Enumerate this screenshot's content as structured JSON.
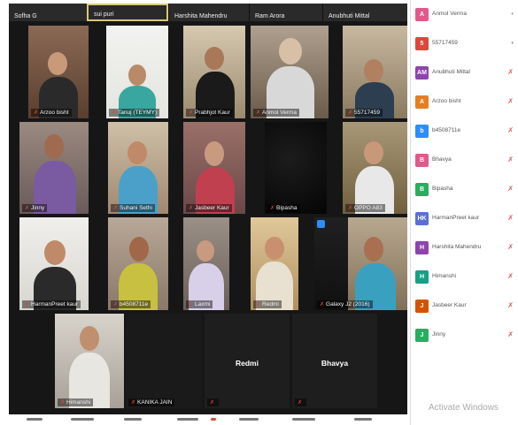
{
  "app": {
    "title": ""
  },
  "top_strip": [
    {
      "name": "Sofha G"
    },
    {
      "name": "sui puri",
      "active": true
    },
    {
      "name": "Harshita Mahendru"
    },
    {
      "name": "Ram Arora"
    },
    {
      "name": "Anubhuti Mittal"
    }
  ],
  "gallery": {
    "row1": [
      {
        "name": "Arzoo bisht"
      },
      {
        "name": "Tanuj (TEYMY)"
      },
      {
        "name": "Prabhjot Kaur"
      },
      {
        "name": "Anmol Verma"
      },
      {
        "name": "55717459"
      }
    ],
    "row2": [
      {
        "name": "Jinny"
      },
      {
        "name": "Suhani Sethi"
      },
      {
        "name": "Jasbeer Kaur"
      },
      {
        "name": "Bipasha"
      },
      {
        "name": "OPPO A83"
      }
    ],
    "row3": [
      {
        "name": "HarmanPreet kaur"
      },
      {
        "name": "b4508711e"
      },
      {
        "name": "Laxmi"
      },
      {
        "name": "Redmi"
      },
      {
        "name": "Galaxy J2 (2016)"
      }
    ],
    "row4": [
      {
        "name": "Himanshi"
      },
      {
        "name": "KANIKA JAIN"
      },
      {
        "name": "Redmi"
      },
      {
        "name": "Bhavya"
      }
    ]
  },
  "participants": [
    {
      "name": "Anmol Verma",
      "initials": "A",
      "color": "#e05a8a",
      "muted": false
    },
    {
      "name": "55717459",
      "initials": "5",
      "color": "#e0463b",
      "muted": false
    },
    {
      "name": "Anubhuti Mittal",
      "initials": "AM",
      "color": "#8e44ad",
      "muted": true
    },
    {
      "name": "Arzoo bisht",
      "initials": "A",
      "color": "#e67e22",
      "muted": true
    },
    {
      "name": "b4508711e",
      "initials": "b",
      "color": "#2d8cff",
      "muted": true
    },
    {
      "name": "Bhavya",
      "initials": "B",
      "color": "#e05a8a",
      "muted": true
    },
    {
      "name": "Bipasha",
      "initials": "B",
      "color": "#27ae60",
      "muted": true
    },
    {
      "name": "HarmanPreet kaur",
      "initials": "HK",
      "color": "#5b6fd6",
      "muted": true
    },
    {
      "name": "Harshita Mahendru",
      "initials": "H",
      "color": "#8e44ad",
      "muted": true
    },
    {
      "name": "Himanshi",
      "initials": "H",
      "color": "#16a085",
      "muted": true
    },
    {
      "name": "Jasbeer Kaur",
      "initials": "J",
      "color": "#d35400",
      "muted": true
    },
    {
      "name": "Jinny",
      "initials": "J",
      "color": "#27ae60",
      "muted": true
    }
  ],
  "watermark": "Activate Windows",
  "icons": {
    "muted_mic": "mic-muted-icon",
    "mic": "mic-icon"
  }
}
